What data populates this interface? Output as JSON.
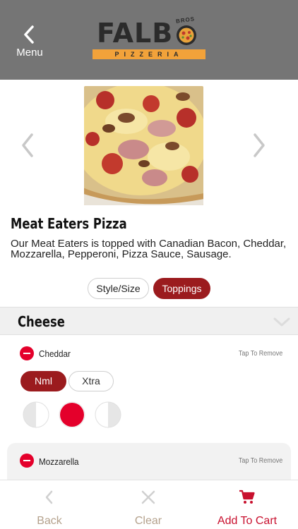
{
  "header": {
    "menu_label": "Menu",
    "logo_word": "FALB",
    "logo_sub": "PIZZERIA",
    "logo_bros": "BROS"
  },
  "product": {
    "title": "Meat Eaters Pizza",
    "description": "Our Meat Eaters is topped with Canadian Bacon, Cheddar, Mozzarella, Pepperoni, Pizza Sauce, Sausage."
  },
  "tabs": [
    {
      "label": "Style/Size",
      "active": false
    },
    {
      "label": "Toppings",
      "active": true
    }
  ],
  "section": {
    "name": "Cheese"
  },
  "toppings": [
    {
      "name": "Cheddar",
      "action": "Tap To Remove",
      "amount_options": [
        "Nml",
        "Xtra"
      ],
      "selected_amount": "Nml",
      "coverage": "whole"
    },
    {
      "name": "Mozzarella",
      "action": "Tap To Remove"
    }
  ],
  "bottom_bar": {
    "back_label": "Back",
    "clear_label": "Clear",
    "cart_label": "Add To Cart"
  },
  "colors": {
    "header_bg": "#757575",
    "accent": "#9b1b1e",
    "remove_red": "#e4002b",
    "cart_red": "#c8102e",
    "logo_orange": "#f2a23a"
  },
  "icons": {
    "menu": "chevron-left-icon",
    "prev": "chevron-left-icon",
    "next": "chevron-right-icon",
    "section": "chevron-down-icon",
    "back": "chevron-left-icon",
    "clear": "x-icon",
    "cart": "cart-icon"
  }
}
